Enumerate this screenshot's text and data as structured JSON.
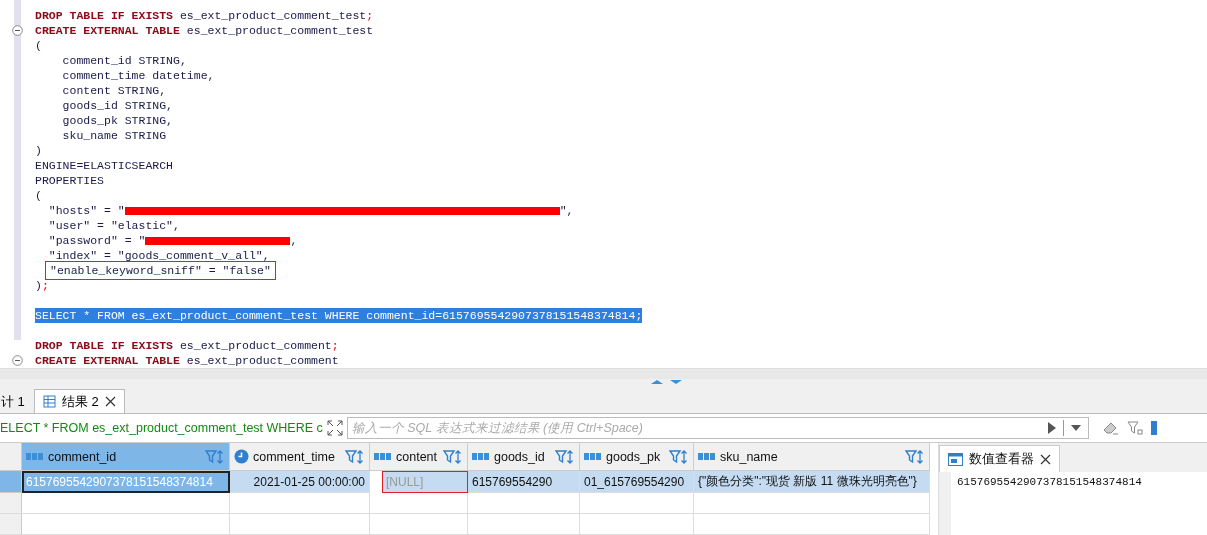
{
  "editor": {
    "lines": [
      {
        "kind": "code",
        "tokens": [
          {
            "kind": "keyword",
            "text": "DROP TABLE IF EXISTS"
          },
          {
            "kind": "text",
            "text": " es_ext_product_comment_test"
          },
          {
            "kind": "punct",
            "text": ";"
          }
        ]
      },
      {
        "kind": "fold",
        "tokens": [
          {
            "kind": "keyword",
            "text": "CREATE EXTERNAL TABLE"
          },
          {
            "kind": "text",
            "text": " es_ext_product_comment_test"
          }
        ]
      },
      {
        "kind": "code",
        "tokens": [
          {
            "kind": "text",
            "text": "("
          }
        ]
      },
      {
        "kind": "code",
        "tokens": [
          {
            "kind": "text",
            "text": "    comment_id STRING,"
          }
        ]
      },
      {
        "kind": "code",
        "tokens": [
          {
            "kind": "text",
            "text": "    comment_time datetime,"
          }
        ]
      },
      {
        "kind": "code",
        "tokens": [
          {
            "kind": "text",
            "text": "    content STRING,"
          }
        ]
      },
      {
        "kind": "code",
        "tokens": [
          {
            "kind": "text",
            "text": "    goods_id STRING,"
          }
        ]
      },
      {
        "kind": "code",
        "tokens": [
          {
            "kind": "text",
            "text": "    goods_pk STRING,"
          }
        ]
      },
      {
        "kind": "code",
        "tokens": [
          {
            "kind": "text",
            "text": "    sku_name STRING"
          }
        ]
      },
      {
        "kind": "code",
        "tokens": [
          {
            "kind": "text",
            "text": ")"
          }
        ]
      },
      {
        "kind": "code",
        "tokens": [
          {
            "kind": "text",
            "text": "ENGINE=ELASTICSEARCH"
          }
        ]
      },
      {
        "kind": "code",
        "tokens": [
          {
            "kind": "text",
            "text": "PROPERTIES"
          }
        ]
      },
      {
        "kind": "code",
        "tokens": [
          {
            "kind": "text",
            "text": "("
          }
        ]
      },
      {
        "kind": "code",
        "tokens": [
          {
            "kind": "text",
            "text": "  \"hosts\" = \""
          },
          {
            "kind": "redaction"
          },
          {
            "kind": "text",
            "text": "\","
          }
        ]
      },
      {
        "kind": "code",
        "tokens": [
          {
            "kind": "text",
            "text": "  \"user\" = \"elastic\","
          }
        ]
      },
      {
        "kind": "code",
        "tokens": [
          {
            "kind": "text",
            "text": "  \"password\" = \""
          },
          {
            "kind": "redaction_short"
          },
          {
            "kind": "text",
            "text": ","
          }
        ]
      },
      {
        "kind": "code",
        "tokens": [
          {
            "kind": "text",
            "text": "  \"index\" = \"goods_comment_v_all\","
          }
        ]
      },
      {
        "kind": "annotated",
        "tokens": [
          {
            "kind": "text",
            "text": "\"enable_keyword_sniff\" = \"false\""
          }
        ]
      },
      {
        "kind": "code",
        "tokens": [
          {
            "kind": "text",
            "text": ")"
          },
          {
            "kind": "punct",
            "text": ";"
          }
        ]
      },
      {
        "kind": "blank"
      },
      {
        "kind": "selected",
        "tokens": [
          {
            "kind": "text",
            "text": "SELECT * FROM es_ext_product_comment_test WHERE comment_id=6157695542907378151548374814;"
          }
        ]
      },
      {
        "kind": "blank"
      },
      {
        "kind": "code",
        "tokens": [
          {
            "kind": "keyword",
            "text": "DROP TABLE IF EXISTS"
          },
          {
            "kind": "text",
            "text": " es_ext_product_comment"
          },
          {
            "kind": "punct",
            "text": ";"
          }
        ]
      },
      {
        "kind": "fold",
        "tokens": [
          {
            "kind": "keyword",
            "text": "CREATE EXTERNAL TABLE"
          },
          {
            "kind": "text",
            "text": " es_ext_product_comment"
          }
        ]
      }
    ]
  },
  "tabs": [
    {
      "label": "计 1",
      "selected": false,
      "closable": false
    },
    {
      "label": "结果 2",
      "selected": true,
      "closable": true
    }
  ],
  "filter": {
    "query": "ELECT * FROM es_ext_product_comment_test WHERE c",
    "placeholder": "输入一个 SQL 表达式来过滤结果 (使用 Ctrl+Space)"
  },
  "grid": {
    "columns": [
      {
        "name": "comment_id",
        "kind": "text",
        "selected": true
      },
      {
        "name": "comment_time",
        "kind": "datetime",
        "selected": false
      },
      {
        "name": "content",
        "kind": "text",
        "selected": false
      },
      {
        "name": "goods_id",
        "kind": "text",
        "selected": false
      },
      {
        "name": "goods_pk",
        "kind": "text",
        "selected": false
      },
      {
        "name": "sku_name",
        "kind": "text",
        "selected": false
      }
    ],
    "rows": [
      {
        "selected": true,
        "cells": [
          {
            "text": "6157695542907378151548374814",
            "kind": "value",
            "focused": true,
            "annotated": false
          },
          {
            "text": "2021-01-25 00:00:00",
            "kind": "value",
            "focused": false,
            "annotated": false
          },
          {
            "text": "[NULL]",
            "kind": "null",
            "focused": false,
            "annotated": true
          },
          {
            "text": "615769554290",
            "kind": "value",
            "focused": false,
            "annotated": false
          },
          {
            "text": "01_615769554290",
            "kind": "value",
            "focused": false,
            "annotated": false
          },
          {
            "text": "{\"颜色分类\":\"现货 新版 11 微珠光明亮色\"}",
            "kind": "value",
            "focused": false,
            "annotated": false
          }
        ]
      }
    ]
  },
  "value_viewer": {
    "title": "数值查看器",
    "value": "6157695542907378151548374814"
  }
}
